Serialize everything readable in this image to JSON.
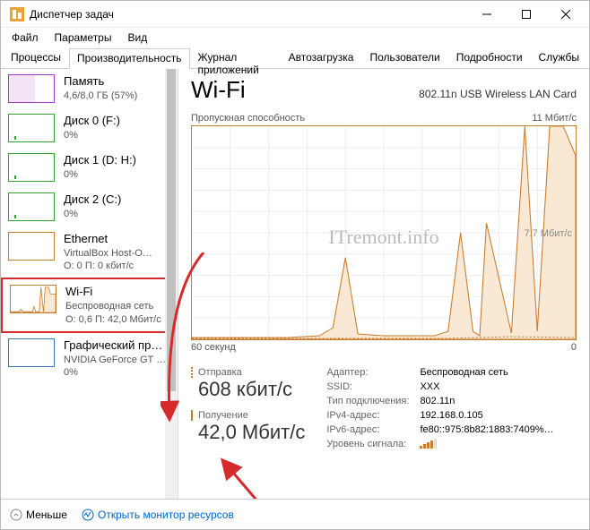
{
  "window": {
    "title": "Диспетчер задач"
  },
  "menu": {
    "file": "Файл",
    "options": "Параметры",
    "view": "Вид"
  },
  "tabs": {
    "processes": "Процессы",
    "performance": "Производительность",
    "history": "Журнал приложений",
    "startup": "Автозагрузка",
    "users": "Пользователи",
    "details": "Подробности",
    "services": "Службы"
  },
  "sidebar": {
    "memory": {
      "title": "Память",
      "sub": "4,6/8,0 ГБ (57%)"
    },
    "disk0": {
      "title": "Диск 0 (F:)",
      "sub": "0%"
    },
    "disk1": {
      "title": "Диск 1 (D: H:)",
      "sub": "0%"
    },
    "disk2": {
      "title": "Диск 2 (C:)",
      "sub": "0%"
    },
    "eth": {
      "title": "Ethernet",
      "sub1": "VirtualBox Host-O…",
      "sub2": "О: 0 П: 0 кбит/с"
    },
    "wifi": {
      "title": "Wi-Fi",
      "sub1": "Беспроводная сеть",
      "sub2": "О: 0,6 П: 42,0 Мбит/с"
    },
    "gpu": {
      "title": "Графический пр…",
      "sub1": "NVIDIA GeForce GT 4…",
      "sub2": "0%"
    }
  },
  "main": {
    "title": "Wi-Fi",
    "adapter": "802.11n USB Wireless LAN Card",
    "chart_lbl": "Пропускная способность",
    "chart_max": "11 Мбит/с",
    "chart_mid": "7,7 Мбит/с",
    "chart_xmin": "60 секунд",
    "chart_xmax": "0",
    "watermark": "ITremont.info",
    "send_lbl": "Отправка",
    "send_val": "608 кбит/с",
    "recv_lbl": "Получение",
    "recv_val": "42,0 Мбит/с"
  },
  "props": {
    "adapter_lbl": "Адаптер:",
    "adapter_val": "Беспроводная сеть",
    "ssid_lbl": "SSID:",
    "ssid_val": "XXX",
    "conn_lbl": "Тип подключения:",
    "conn_val": "802.11n",
    "ipv4_lbl": "IPv4-адрес:",
    "ipv4_val": "192.168.0.105",
    "ipv6_lbl": "IPv6-адрес:",
    "ipv6_val": "fe80::975:8b82:1883:7409%…",
    "signal_lbl": "Уровень сигнала:"
  },
  "bottom": {
    "less": "Меньше",
    "monitor": "Открыть монитор ресурсов"
  },
  "chart_data": {
    "type": "line",
    "title": "Пропускная способность",
    "xlabel": "секунд",
    "ylabel": "Мбит/с",
    "xlim": [
      60,
      0
    ],
    "ylim": [
      0,
      11
    ],
    "series": [
      {
        "name": "recv",
        "color": "#c87d2f",
        "style": "solid",
        "x": [
          60,
          45,
          40,
          38,
          36,
          34,
          30,
          22,
          20,
          18,
          16,
          15,
          14,
          10,
          8,
          6,
          4,
          2,
          0
        ],
        "y": [
          0.1,
          0.1,
          0.2,
          0.6,
          4.2,
          0.3,
          0.2,
          0.2,
          0.4,
          5.5,
          0.4,
          0.2,
          6.0,
          0.3,
          11,
          0.4,
          11,
          11,
          9.5
        ]
      },
      {
        "name": "send",
        "color": "#c87d2f",
        "style": "dotted",
        "x": [
          60,
          40,
          30,
          20,
          10,
          0
        ],
        "y": [
          0.05,
          0.1,
          0.08,
          0.1,
          0.2,
          0.15
        ]
      }
    ]
  }
}
